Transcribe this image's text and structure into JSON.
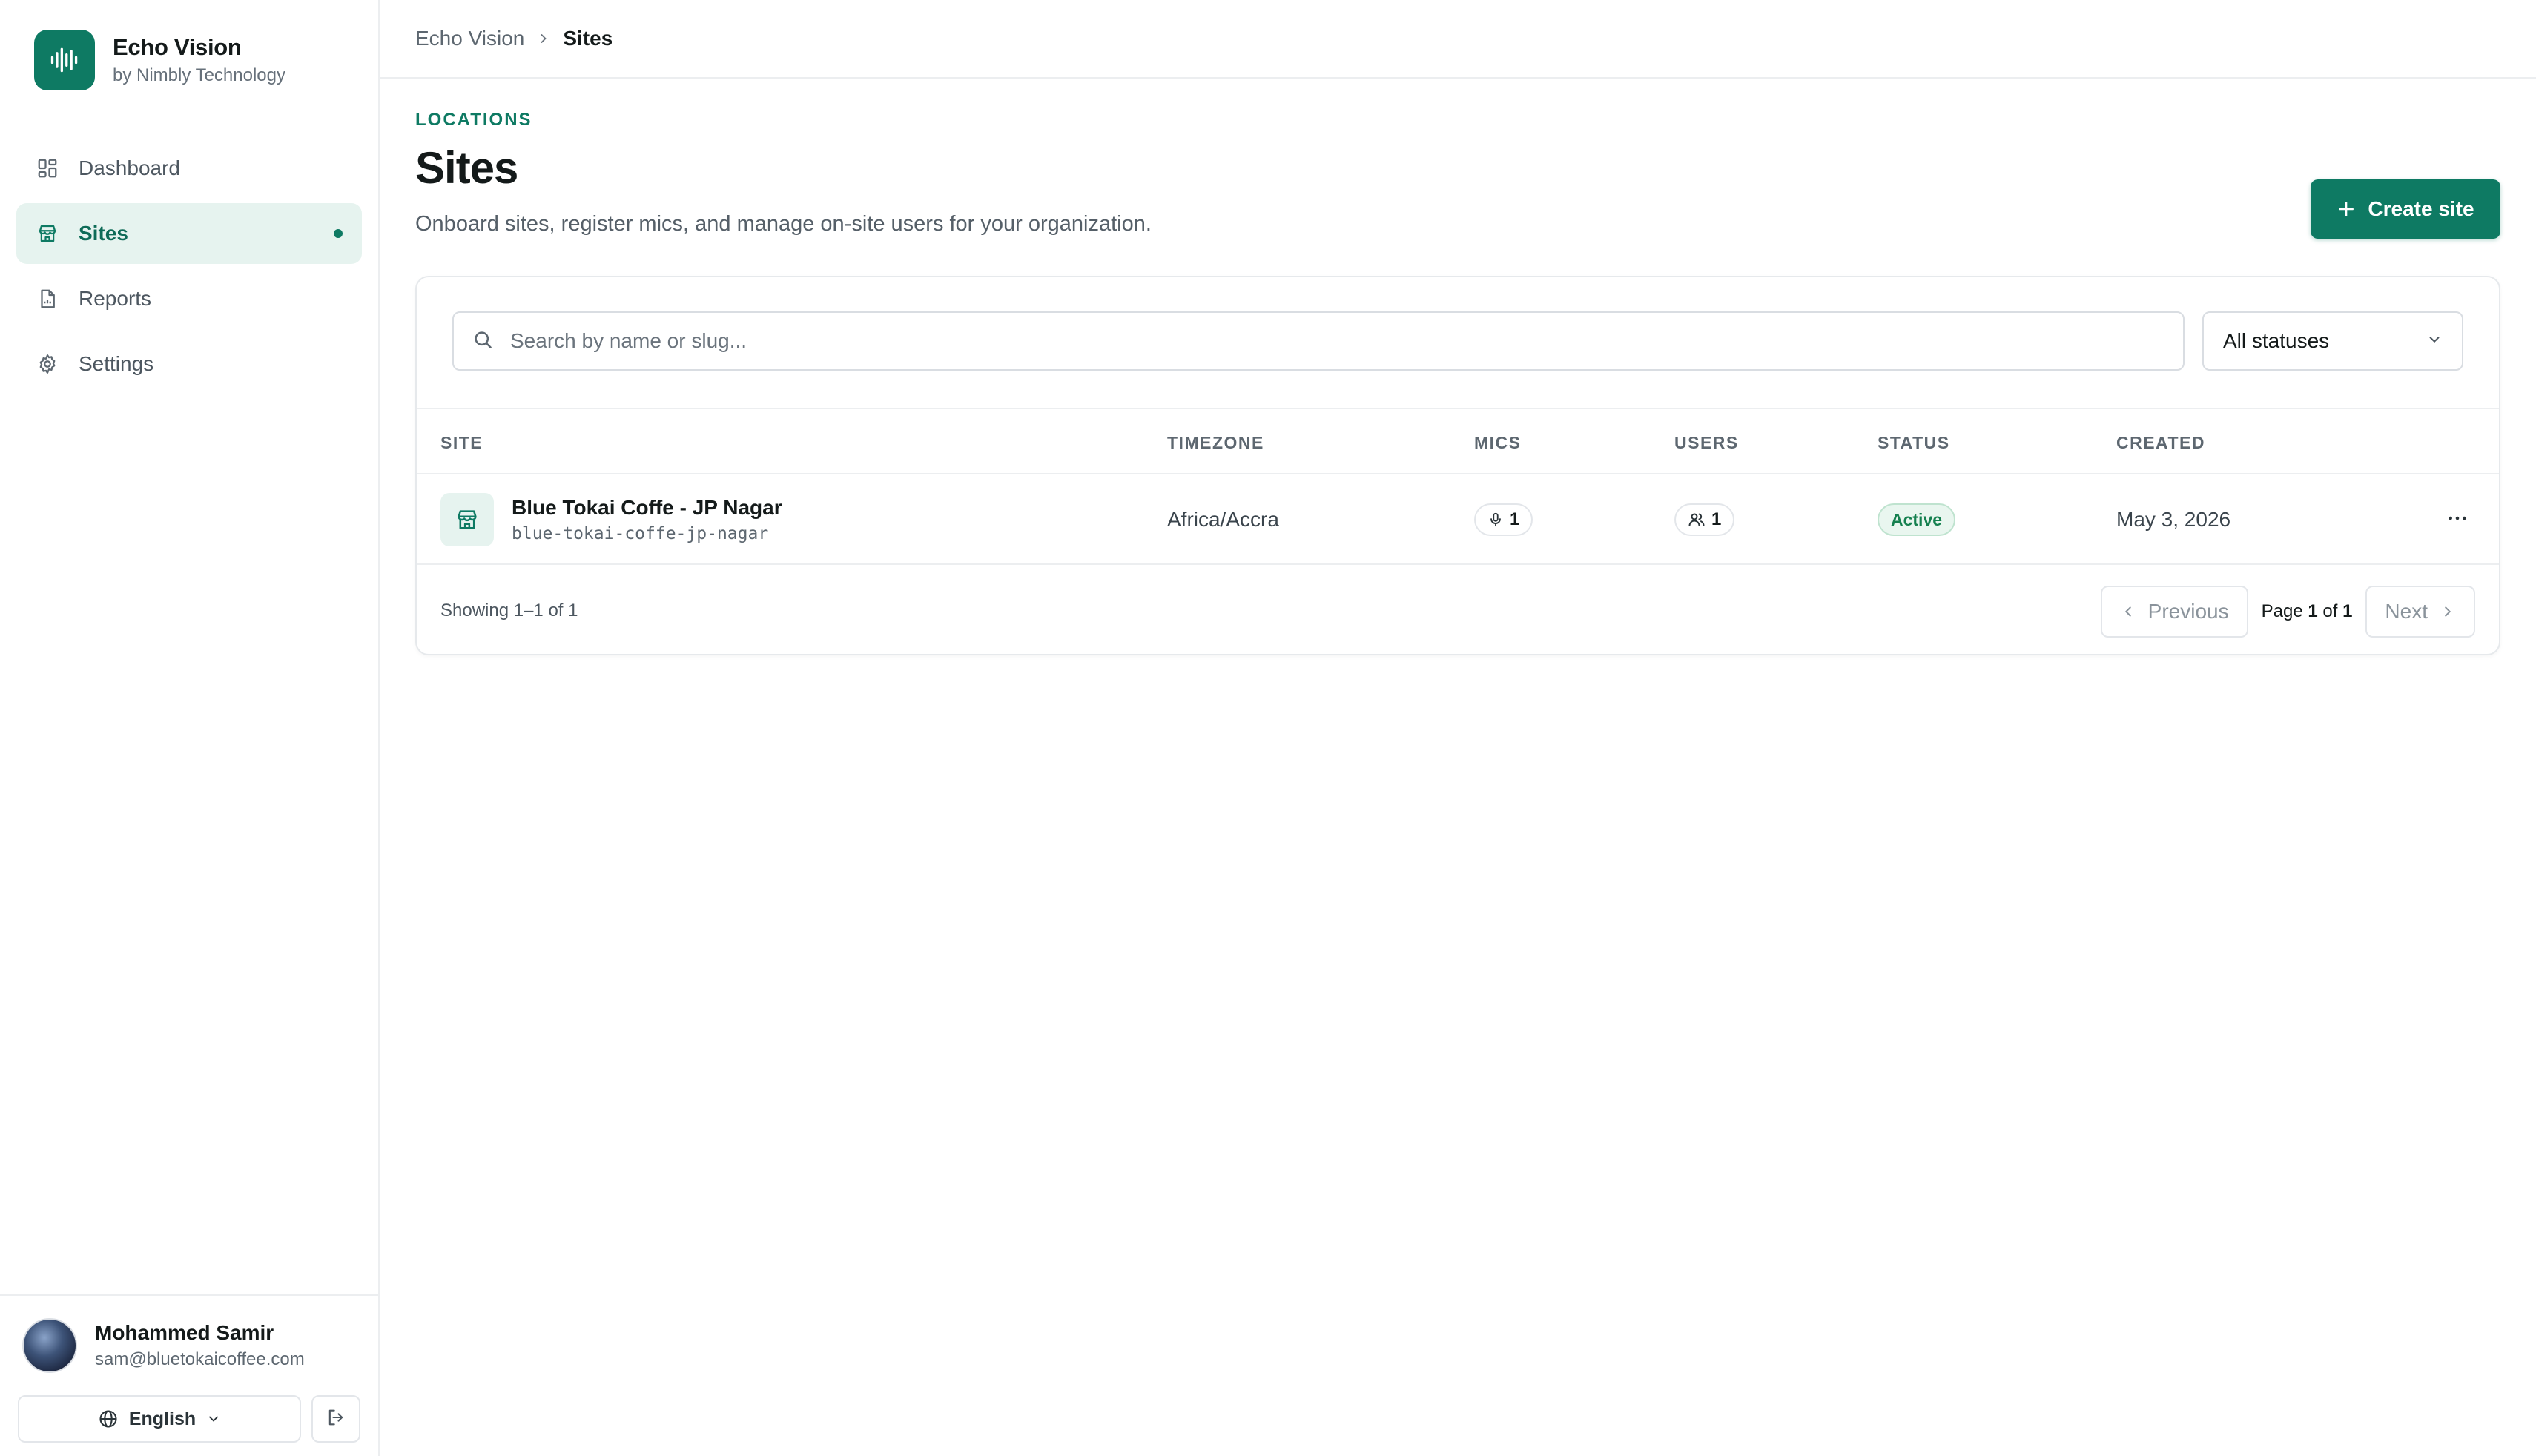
{
  "brand": {
    "name": "Echo Vision",
    "subtitle": "by Nimbly Technology"
  },
  "nav": [
    {
      "label": "Dashboard",
      "icon": "dashboard-icon",
      "active": false
    },
    {
      "label": "Sites",
      "icon": "store-icon",
      "active": true
    },
    {
      "label": "Reports",
      "icon": "file-icon",
      "active": false
    },
    {
      "label": "Settings",
      "icon": "gear-icon",
      "active": false
    }
  ],
  "user": {
    "name": "Mohammed Samir",
    "email": "sam@bluetokaicoffee.com"
  },
  "language": {
    "selected": "English"
  },
  "breadcrumb": {
    "root": "Echo Vision",
    "current": "Sites"
  },
  "page": {
    "eyebrow": "LOCATIONS",
    "title": "Sites",
    "description": "Onboard sites, register mics, and manage on-site users for your organization.",
    "create_label": "Create site"
  },
  "filters": {
    "search_placeholder": "Search by name or slug...",
    "status_selected": "All statuses"
  },
  "table": {
    "columns": [
      "SITE",
      "TIMEZONE",
      "MICS",
      "USERS",
      "STATUS",
      "CREATED"
    ],
    "rows": [
      {
        "name": "Blue Tokai Coffe - JP Nagar",
        "slug": "blue-tokai-coffe-jp-nagar",
        "timezone": "Africa/Accra",
        "mics": "1",
        "users": "1",
        "status": "Active",
        "created": "May 3, 2026"
      }
    ]
  },
  "pagination": {
    "showing": "Showing 1–1 of 1",
    "previous": "Previous",
    "next": "Next",
    "page_prefix": "Page",
    "page_current": "1",
    "page_of": "of",
    "page_total": "1"
  },
  "colors": {
    "accent": "#0e7a63",
    "accent_light": "#e6f3ef",
    "active_badge": "#15804f"
  }
}
